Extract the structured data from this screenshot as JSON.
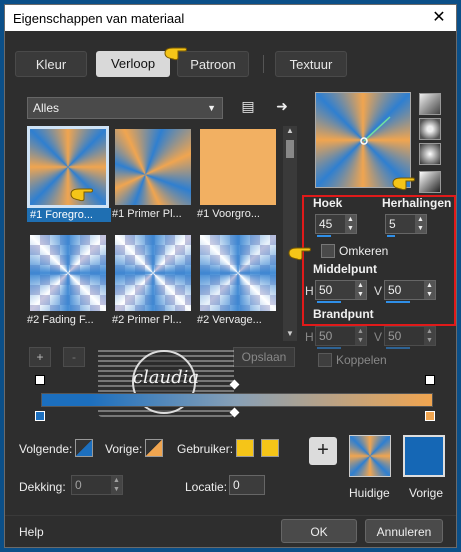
{
  "window": {
    "title": "Eigenschappen van materiaal",
    "close_glyph": "✕"
  },
  "tabs": [
    {
      "label": "Kleur"
    },
    {
      "label": "Verloop",
      "selected": true
    },
    {
      "label": "Patroon"
    },
    {
      "label": "Textuur"
    }
  ],
  "library": {
    "filter_value": "Alles",
    "thumbnails": [
      {
        "caption": "#1 Foregro...",
        "kind": "conic",
        "selected": true
      },
      {
        "caption": "#1 Primer Pl...",
        "kind": "conic"
      },
      {
        "caption": "#1 Voorgro...",
        "kind": "solid"
      },
      {
        "caption": "#2 Fading F...",
        "kind": "checker"
      },
      {
        "caption": "#2 Primer Pl...",
        "kind": "checker"
      },
      {
        "caption": "#2 Vervage...",
        "kind": "checker"
      }
    ],
    "add_label": "+",
    "remove_label": "-",
    "save_label": "Opslaan"
  },
  "settings": {
    "angle_label": "Hoek",
    "angle_value": "45",
    "repeats_label": "Herhalingen",
    "repeats_value": "5",
    "invert_label": "Omkeren",
    "invert_checked": false,
    "center_label": "Middelpunt",
    "center_h_label": "H",
    "center_h_value": "50",
    "center_v_label": "V",
    "center_v_value": "50",
    "focal_label": "Brandpunt",
    "focal_h_label": "H",
    "focal_h_value": "50",
    "focal_v_label": "V",
    "focal_v_value": "50",
    "link_label": "Koppelen"
  },
  "watermark": {
    "text": "claudia"
  },
  "stops": {
    "next_label": "Volgende:",
    "prev_label": "Vorige:",
    "user_label": "Gebruiker:",
    "opacity_label": "Dekking:",
    "opacity_value": "0",
    "location_label": "Locatie:",
    "location_value": "0"
  },
  "swatches": {
    "current_label": "Huidige",
    "previous_label": "Vorige",
    "add_glyph": "+"
  },
  "footer": {
    "help_label": "Help",
    "ok_label": "OK",
    "cancel_label": "Annuleren"
  },
  "colors": {
    "accent": "#1f6fb2",
    "orange": "#f0a550",
    "blue": "#2f7fd0",
    "highlight": "#e01a1a",
    "user_yellow": "#f5c518"
  }
}
